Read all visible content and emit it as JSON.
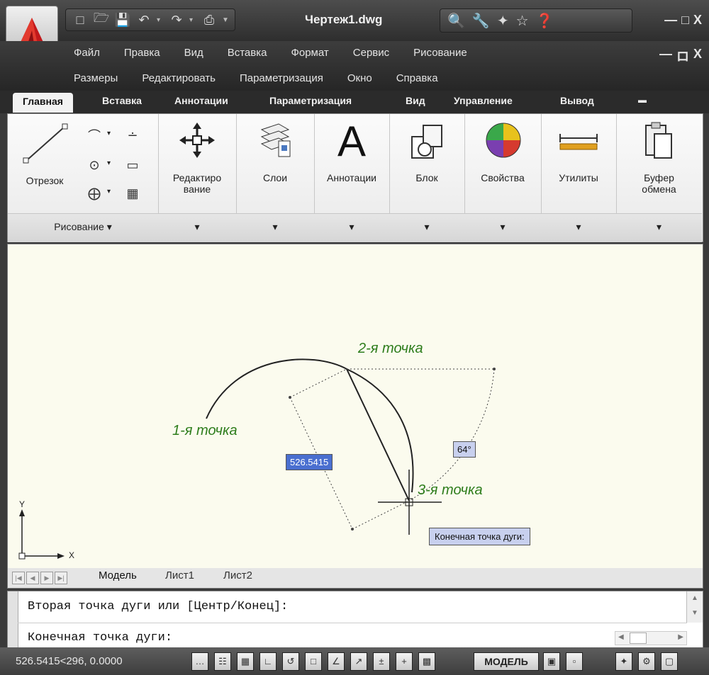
{
  "window": {
    "title": "Чертеж1.dwg",
    "controls": {
      "minimize": "—",
      "maximize": "□",
      "close": "X"
    },
    "doc_controls": {
      "minimize": "—",
      "restore": "ロ",
      "close": "X"
    }
  },
  "menu": {
    "row1": [
      "Файл",
      "Правка",
      "Вид",
      "Вставка",
      "Формат",
      "Сервис",
      "Рисование"
    ],
    "row2": [
      "Размеры",
      "Редактировать",
      "Параметризация",
      "Окно",
      "Справка"
    ]
  },
  "ribbon": {
    "tabs": [
      "Главная",
      "Вставка",
      "Аннотации",
      "Параметризация",
      "Вид",
      "Управление",
      "Вывод"
    ],
    "active_tab": "Главная",
    "draw_panel": {
      "big_button": "Отрезок",
      "panel_label": "Рисование"
    },
    "panels": [
      "Редактиро вание",
      "Слои",
      "Аннотации",
      "Блок",
      "Свойства",
      "Утилиты",
      "Буфер обмена"
    ]
  },
  "drawing": {
    "point1": "1-я точка",
    "point2": "2-я точка",
    "point3": "3-я точка",
    "distance_input": "526.5415",
    "angle_input": "64°",
    "tooltip": "Конечная точка дуги:",
    "ucs_x": "X",
    "ucs_y": "Y"
  },
  "layout_tabs": [
    "Модель",
    "Лист1",
    "Лист2"
  ],
  "command": {
    "line1": "Вторая точка дуги или [Центр/Конец]:",
    "line2": "Конечная точка дуги:"
  },
  "status": {
    "coords": "526.5415<296, 0.0000",
    "model": "МОДЕЛЬ"
  },
  "colors": {
    "accent_green": "#2e7d1c",
    "canvas_bg": "#fbfbee",
    "dynamic_input": "#c8d0ee"
  }
}
